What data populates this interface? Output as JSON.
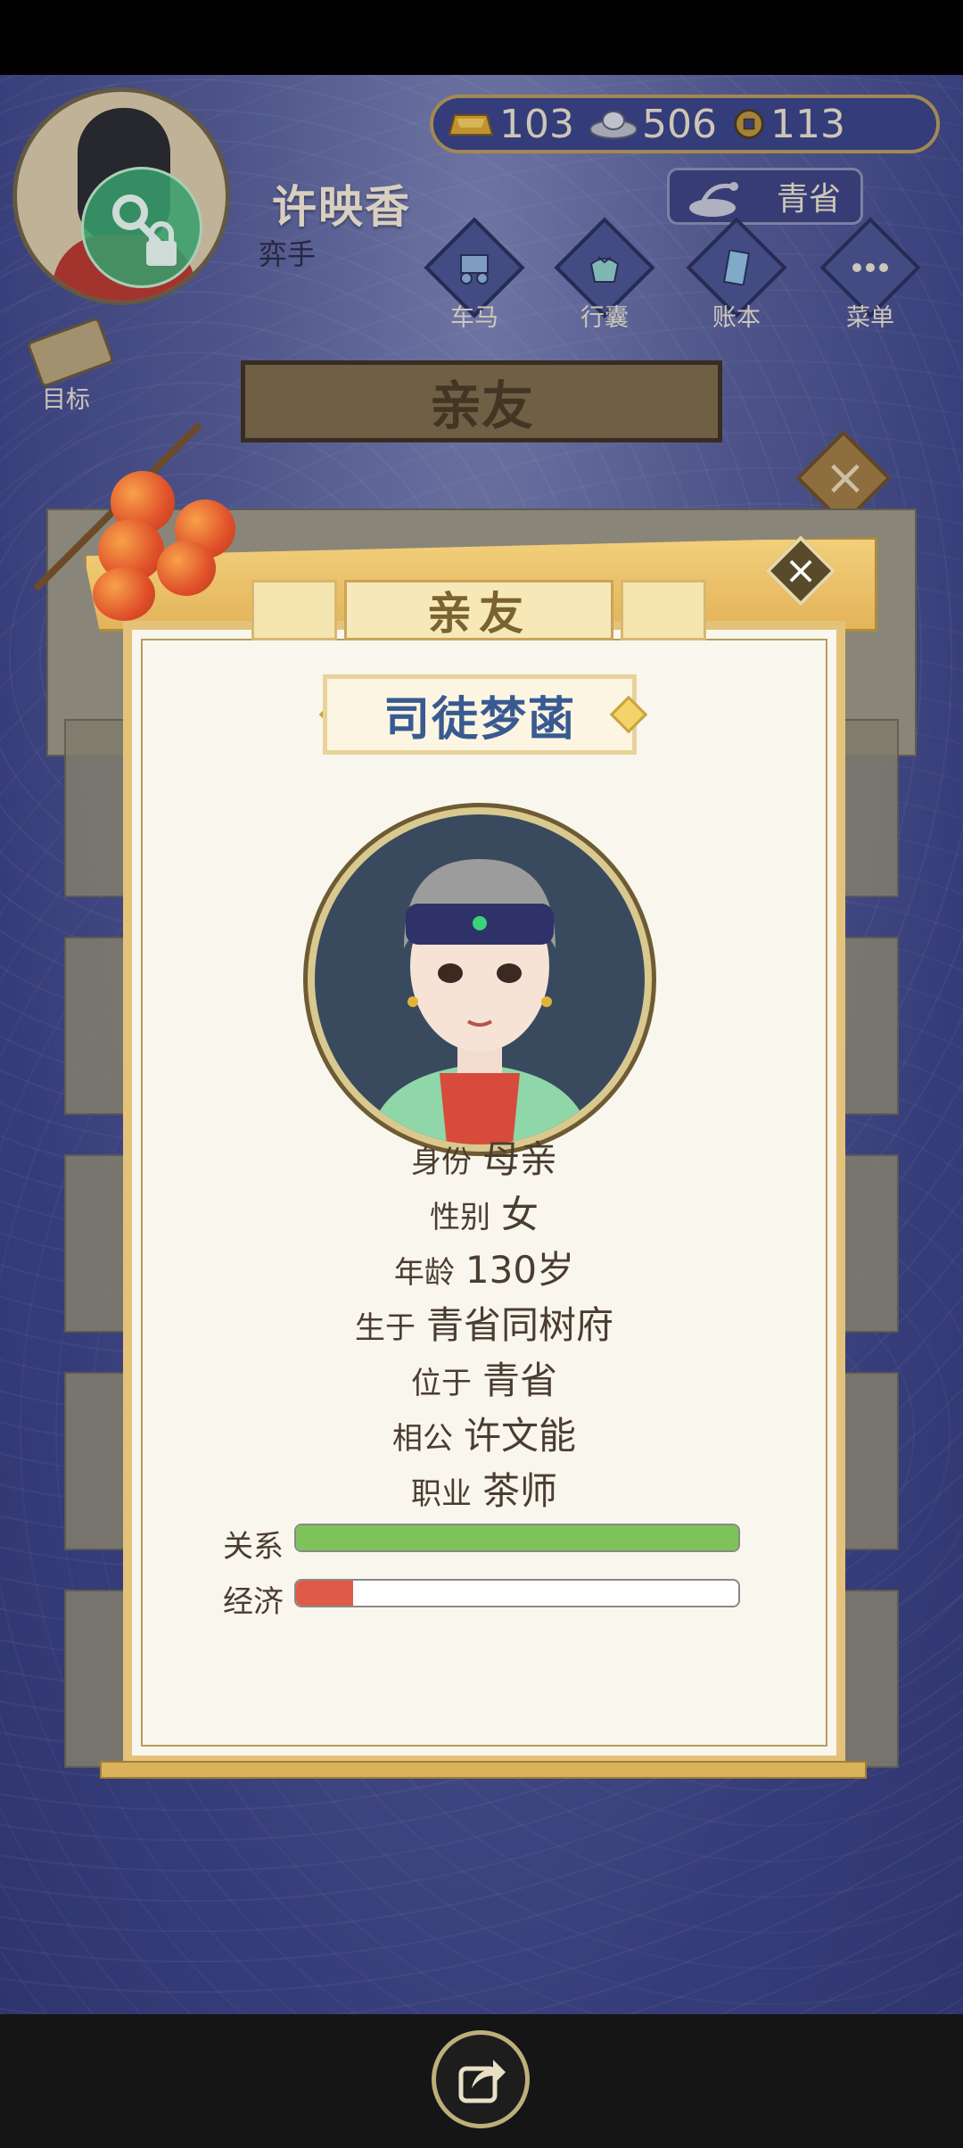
{
  "player": {
    "name": "许映香",
    "title": "弈手"
  },
  "currency": [
    {
      "icon": "gold-ingot-icon",
      "value": "103"
    },
    {
      "icon": "silver-ingot-icon",
      "value": "506"
    },
    {
      "icon": "copper-coin-icon",
      "value": "113"
    }
  ],
  "location": {
    "label": "青省"
  },
  "nav": [
    {
      "icon": "carriage-icon",
      "label": "车马"
    },
    {
      "icon": "bag-icon",
      "label": "行囊"
    },
    {
      "icon": "ledger-icon",
      "label": "账本"
    },
    {
      "icon": "menu-dots-icon",
      "label": "菜单"
    }
  ],
  "goal": {
    "label": "目标"
  },
  "background_panel": {
    "title": "亲友"
  },
  "modal": {
    "tab_title": "亲友",
    "name": "司徒梦菡",
    "fields": [
      {
        "key": "身份",
        "value": "母亲"
      },
      {
        "key": "性别",
        "value": "女"
      },
      {
        "key": "年龄",
        "value": "130岁"
      },
      {
        "key": "生于",
        "value": "青省同树府"
      },
      {
        "key": "位于",
        "value": "青省"
      },
      {
        "key": "相公",
        "value": "许文能"
      },
      {
        "key": "职业",
        "value": "茶师"
      }
    ],
    "bars": [
      {
        "label": "关系",
        "value": 1.0,
        "color": "#7dc35a"
      },
      {
        "label": "经济",
        "value": 0.13,
        "color": "#e05a48"
      }
    ]
  },
  "colors": {
    "accent_gold": "#e5c27a",
    "name_blue": "#395a91",
    "bg_indigo": "#3c4385"
  }
}
